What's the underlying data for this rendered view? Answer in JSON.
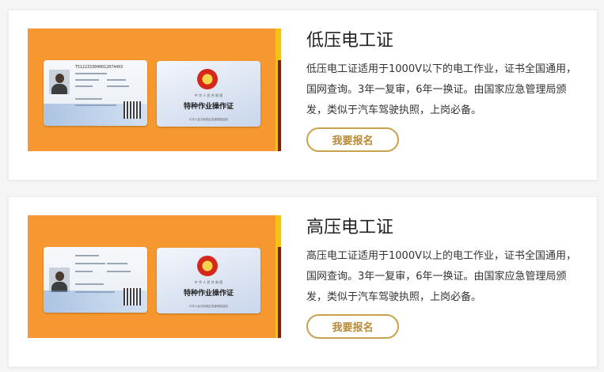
{
  "cards": [
    {
      "title": "低压电工证",
      "description": "低压电工证适用于1000V以下的电工作业，证书全国通用，国网查询。3年一复审，6年一换证。由国家应急管理局颁发，类似于汽车驾驶执照，上岗必备。",
      "button_label": "我要报名",
      "license_number": "T51223330400120744XX",
      "cert_header": "中 华 人 民 共 和 国",
      "cert_title": "特种作业操作证",
      "cert_footer": "中华人民共和国应急管理部监制"
    },
    {
      "title": "高压电工证",
      "description": "高压电工证适用于1000V以上的电工作业，证书全国通用，国网查询。3年一复审，6年一换证。由国家应急管理局颁发，类似于汽车驾驶执照，上岗必备。",
      "button_label": "我要报名",
      "license_number": "",
      "cert_header": "中 华 人 民 共 和 国",
      "cert_title": "特种作业操作证",
      "cert_footer": "中华人民共和国应急管理部监制"
    }
  ],
  "colors": {
    "banner": "#f6982f",
    "button_border": "#c9a24f",
    "button_text": "#b88a34"
  }
}
